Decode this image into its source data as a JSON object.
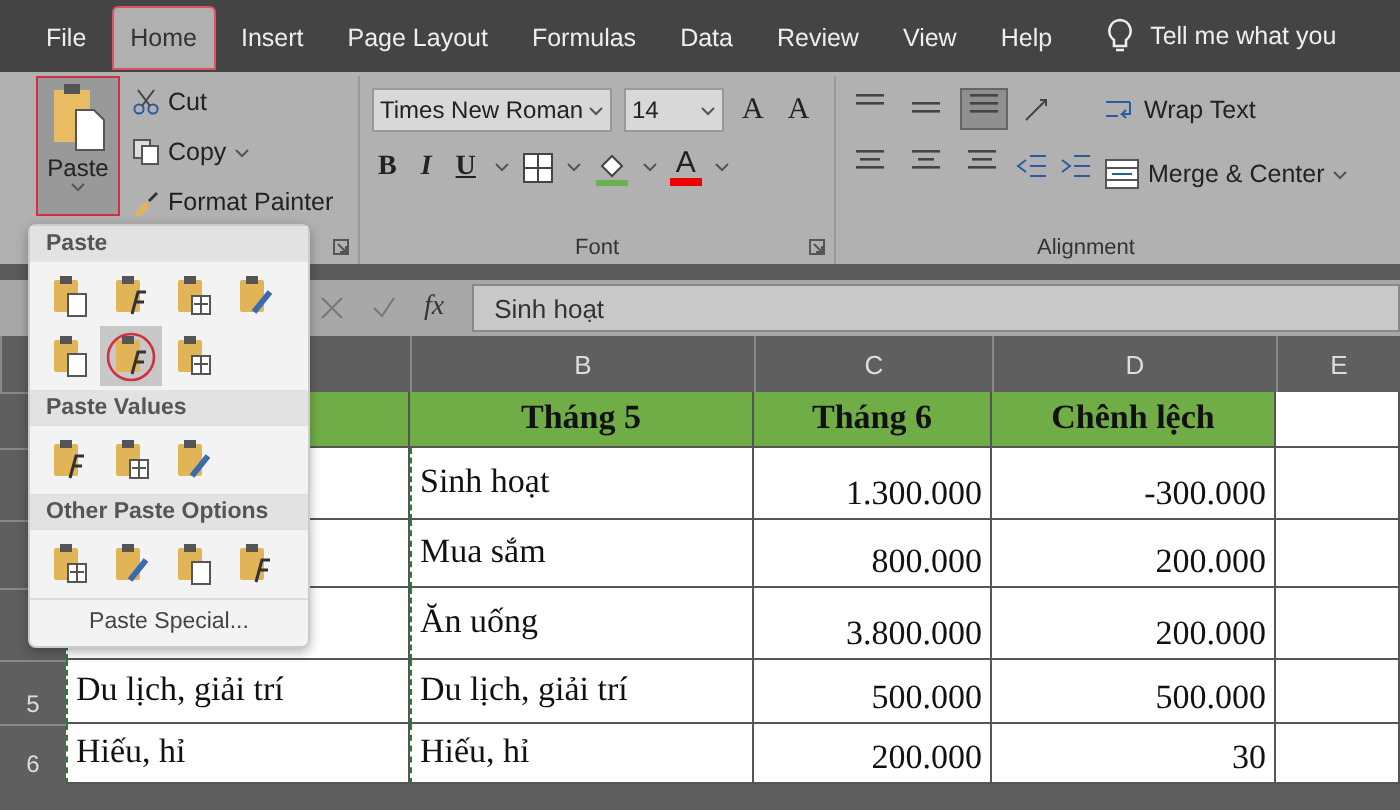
{
  "tabs": [
    {
      "label": "File",
      "selected": false
    },
    {
      "label": "Home",
      "selected": true
    },
    {
      "label": "Insert",
      "selected": false
    },
    {
      "label": "Page Layout",
      "selected": false
    },
    {
      "label": "Formulas",
      "selected": false
    },
    {
      "label": "Data",
      "selected": false
    },
    {
      "label": "Review",
      "selected": false
    },
    {
      "label": "View",
      "selected": false
    },
    {
      "label": "Help",
      "selected": false
    }
  ],
  "tell_me": "Tell me what you",
  "clipboard": {
    "paste_label": "Paste",
    "paste_pressed": true,
    "cut": "Cut",
    "copy": "Copy",
    "format_painter": "Format Painter"
  },
  "font": {
    "name": "Times New Roman",
    "size": "14",
    "grow": "A",
    "shrink": "A",
    "bold": "B",
    "italic": "I",
    "underline": "U",
    "font_color": "A",
    "label": "Font"
  },
  "alignment": {
    "vertical_align": [
      {
        "selected": false
      },
      {
        "selected": false
      },
      {
        "selected": true
      }
    ],
    "wrap_text": "Wrap Text",
    "merge": "Merge & Center",
    "label": "Alignment"
  },
  "formula_bar": {
    "fx": "fx",
    "value": "Sinh hoạt"
  },
  "columns": [
    "B",
    "C",
    "D",
    "E"
  ],
  "header_row": [
    "Tháng 5",
    "Tháng 6",
    "Chênh lệch"
  ],
  "rows": [
    {
      "cells": [
        "Sinh hoạt",
        "1.300.000",
        "-300.000"
      ]
    },
    {
      "cells": [
        "Mua sắm",
        "800.000",
        "200.000"
      ]
    },
    {
      "cells": [
        "Ăn uống",
        "3.800.000",
        "200.000"
      ]
    },
    {
      "number": "5",
      "a": "Du lịch, giải trí",
      "cells": [
        "Du lịch, giải trí",
        "500.000",
        "500.000"
      ]
    },
    {
      "number": "6",
      "a": "Hiếu, hỉ",
      "cells": [
        "Hiếu, hỉ",
        "200.000",
        "30"
      ]
    }
  ],
  "paste_menu": {
    "sections": [
      {
        "heading": "Paste",
        "options": [
          {
            "selected": false
          },
          {
            "selected": false
          },
          {
            "selected": false
          },
          {
            "selected": false
          },
          {
            "selected": false
          },
          {
            "selected": true
          },
          {
            "selected": false
          }
        ]
      },
      {
        "heading": "Paste Values",
        "options": [
          {
            "selected": false
          },
          {
            "selected": false
          },
          {
            "selected": false
          }
        ]
      },
      {
        "heading": "Other Paste Options",
        "options": [
          {
            "selected": false
          },
          {
            "selected": false
          },
          {
            "selected": false
          },
          {
            "selected": false
          }
        ]
      }
    ],
    "paste_special": "Paste Special..."
  }
}
